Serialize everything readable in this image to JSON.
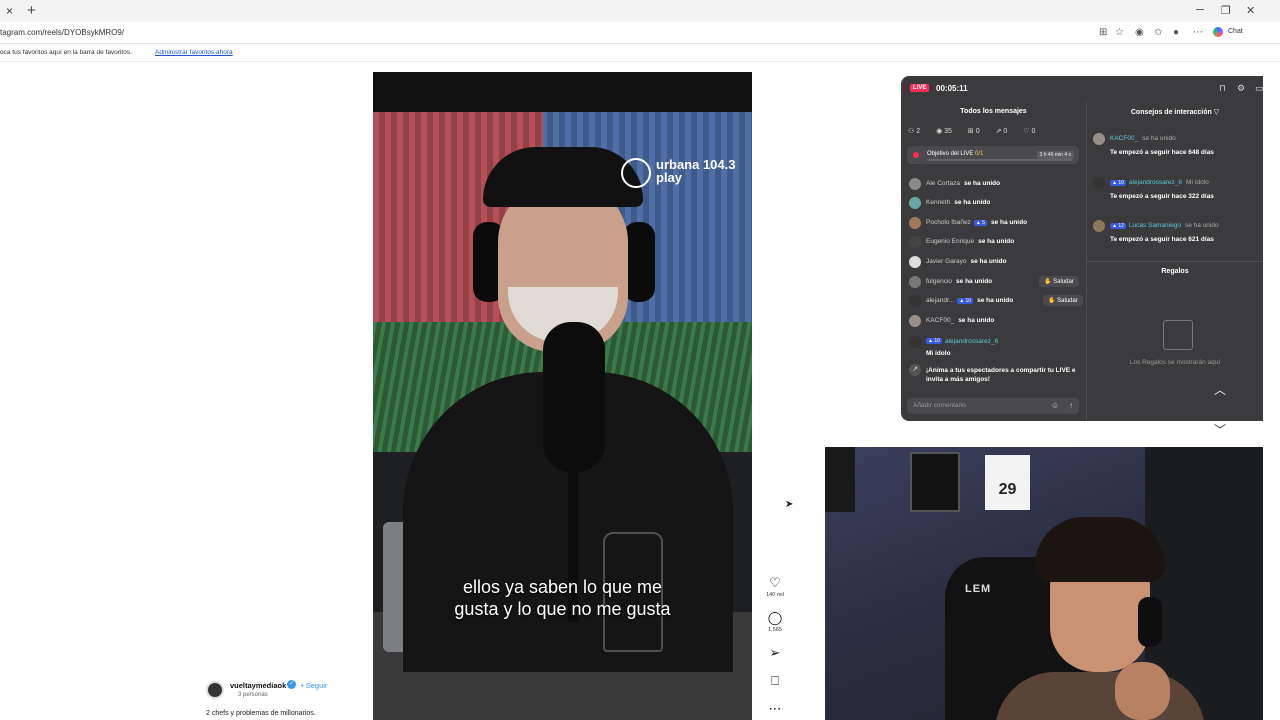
{
  "browser": {
    "url": "tagram.com/reels/DYOBsykMRO9/",
    "new_tab": "+",
    "close_tab": "×",
    "chat_label": "Chat",
    "favorites_bar_text": "oca tus favoritos aquí en la barra de favoritos.",
    "favorites_link": "Administrar favoritos ahora"
  },
  "reel": {
    "brand": "urbana 104.3 play",
    "caption": "ellos ya saben lo que me\ngusta y lo que no me gusta",
    "likes": "140 mil",
    "comments": "1.565"
  },
  "post": {
    "username": "vueltaymediaok",
    "follow_label": "Seguir",
    "followers": "3 personas",
    "caption": "2 chefs y problemas de millonarios."
  },
  "live": {
    "badge": "LIVE",
    "timer": "00:05:11",
    "all_messages_title": "Todos los mensajes",
    "tips_title": "Consejos de interacción",
    "stats": {
      "people": "2",
      "views": "35",
      "gifts": "0",
      "shares": "0",
      "likes": "0"
    },
    "goal": {
      "label": "Objetivo del LIVE",
      "progress": "0/1",
      "time": "3 h 46 min 4 s"
    },
    "messages": [
      {
        "name": "Ale Cortaza",
        "action": "se ha unido"
      },
      {
        "name": "Kenneth",
        "action": "se ha unido"
      },
      {
        "name": "Pocholo Ibañez",
        "level": "5",
        "action": "se ha unido"
      },
      {
        "name": "Eugenio Enrique",
        "action": "se ha unido"
      },
      {
        "name": "Javier Garayo",
        "action": "se ha unido"
      },
      {
        "name": "fulgencio",
        "action": "se ha unido",
        "greet": "Saludar"
      },
      {
        "name": "alejandr...",
        "level": "10",
        "action": "se ha unido",
        "greet": "Saludar"
      },
      {
        "name": "KACF00_",
        "action": "se ha unido"
      }
    ],
    "comment_msg": {
      "level": "10",
      "name": "alejandrossarez_6",
      "text": "Mi ídolo"
    },
    "share_prompt": "¡Anima a tus espectadores a compartir tu LIVE e invita a más amigos!",
    "comment_placeholder": "Añadir comentario",
    "tips": [
      {
        "name": "KACF00_",
        "action": "se ha unido",
        "text": "Te empezó a seguir hace 648 días"
      },
      {
        "level": "10",
        "name": "alejandrossarez_6",
        "action": "Mi ídolo",
        "text": "Te empezó a seguir hace 322 días"
      },
      {
        "level": "12",
        "name": "Lucas Samaniego",
        "action": "se ha unido",
        "text": "Te empezó a seguir hace 621 días"
      }
    ],
    "gifts_title": "Regalos",
    "gifts_empty": "Los Regalos se mostrarán aquí"
  },
  "webcam": {
    "jersey_number": "29",
    "chair_brand": "LEM"
  }
}
